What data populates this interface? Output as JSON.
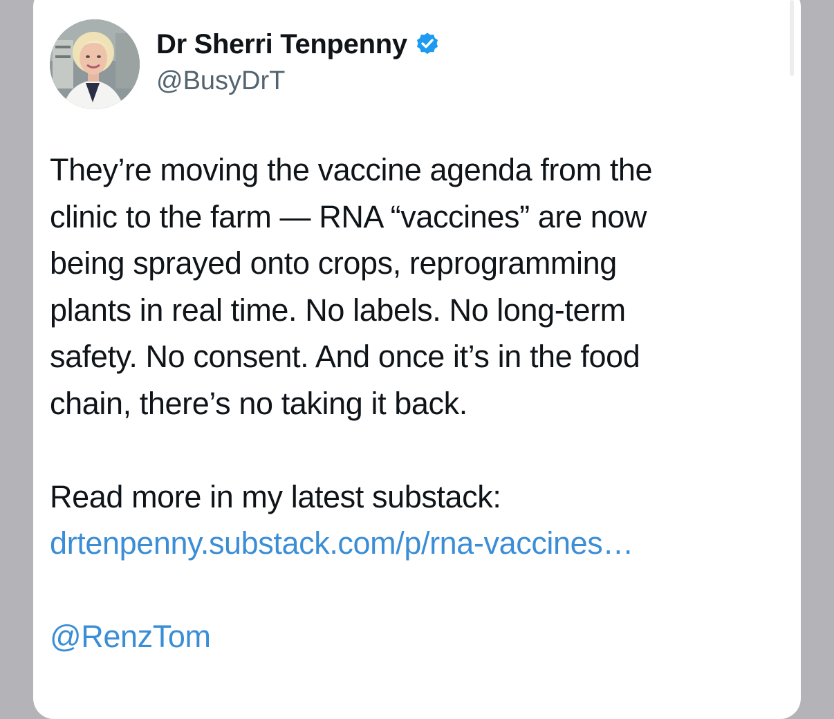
{
  "tweet": {
    "author": {
      "display_name": "Dr Sherri Tenpenny",
      "handle": "@BusyDrT",
      "verified": true,
      "verified_icon": "verified-badge-icon",
      "avatar": "profile-photo"
    },
    "body_lines": [
      "They’re moving the vaccine agenda from the",
      "clinic to the farm — RNA “vaccines” are now",
      "being sprayed onto crops, reprogramming",
      "plants in real time. No labels. No long-term",
      "safety. No consent. And once it’s in the food",
      "chain, there’s no taking it back."
    ],
    "read_more": "Read more in my latest substack:",
    "link": "drtenpenny.substack.com/p/rna-vaccines…",
    "mention": "@RenzTom"
  },
  "colors": {
    "background": "#b3b3b8",
    "card": "#ffffff",
    "text": "#0f1419",
    "secondary_text": "#536471",
    "link": "#3b8ed6",
    "verified": "#1d9bf0"
  }
}
